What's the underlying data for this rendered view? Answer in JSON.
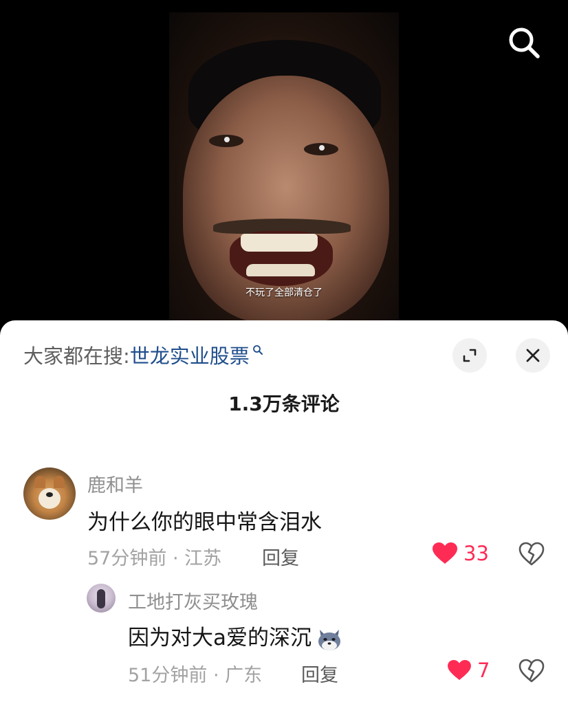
{
  "video": {
    "subtitle": "不玩了全部清仓了",
    "search_icon": "search-icon"
  },
  "sheet": {
    "hot_search": {
      "prefix": "大家都在搜:",
      "keyword": "世龙实业股票",
      "icon": "magnifier-icon"
    },
    "comment_count": "1.3万条评论",
    "expand_icon": "expand-icon",
    "close_icon": "close-icon"
  },
  "comments": [
    {
      "username": "鹿和羊",
      "text": "为什么你的眼中常含泪水",
      "meta": "57分钟前 · 江苏",
      "reply_label": "回复",
      "likes": "33",
      "liked": true,
      "replies": [
        {
          "username": "工地打灰买玫瑰",
          "text": "因为对大a爱的深沉",
          "emoji": "wolf-emoji",
          "meta": "51分钟前 · 广东",
          "reply_label": "回复",
          "likes": "7",
          "liked": true
        }
      ]
    }
  ],
  "colors": {
    "accent_like": "#fe2c55",
    "keyword_blue": "#1f4e8c",
    "sheet_bg": "#ffffff"
  }
}
